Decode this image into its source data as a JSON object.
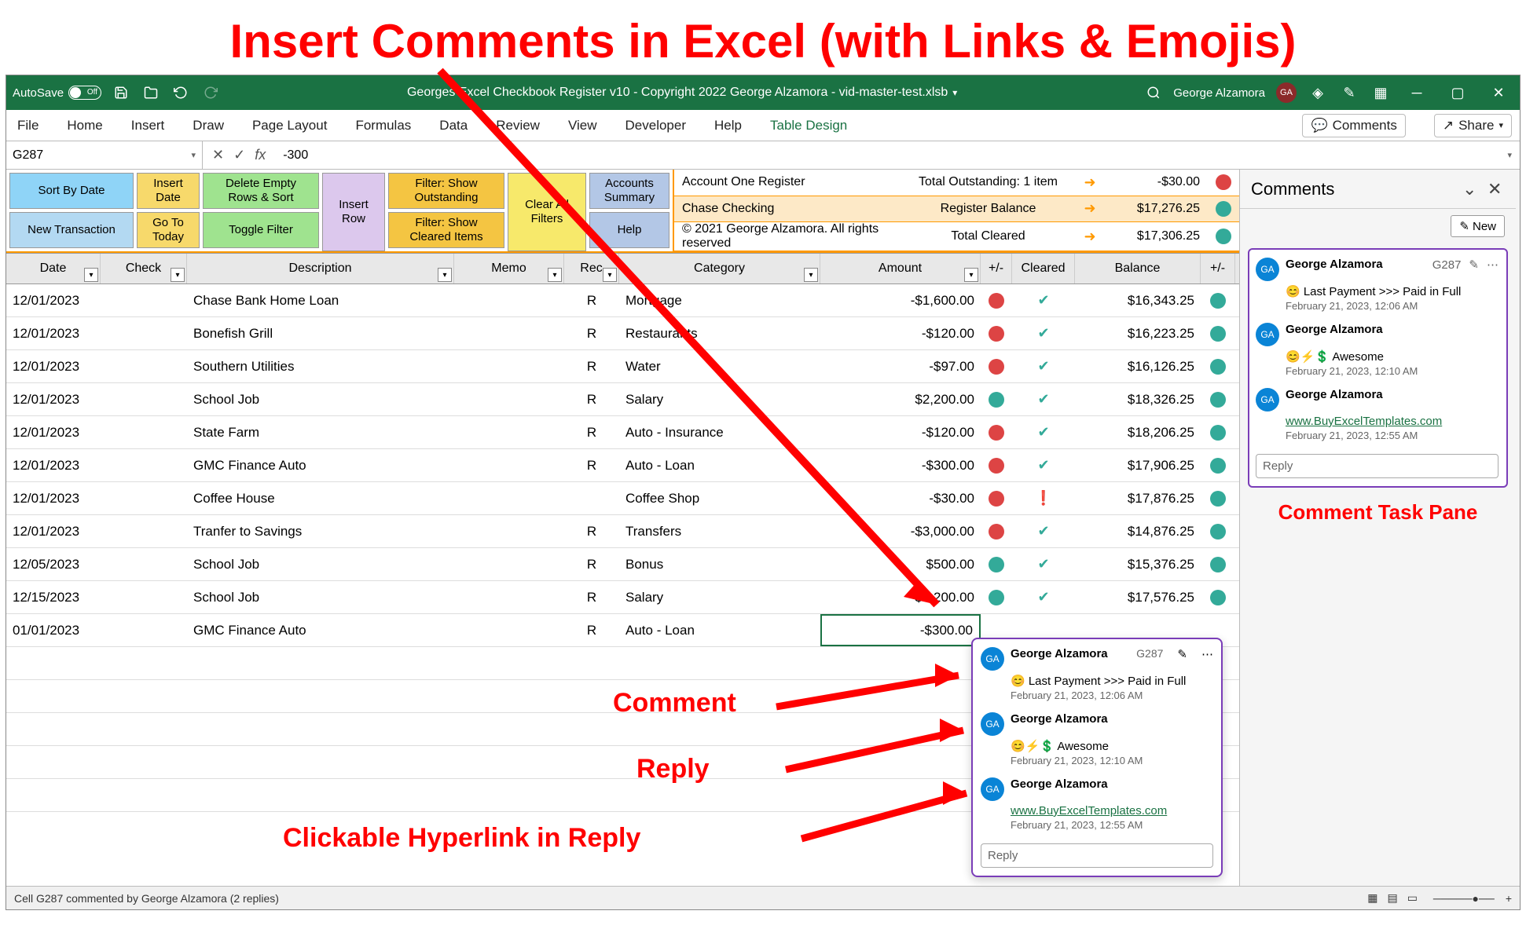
{
  "page_title": "Insert Comments in Excel (with Links & Emojis)",
  "titlebar": {
    "autosave_label": "AutoSave",
    "autosave_state": "Off",
    "doc_title": "Georges Excel Checkbook Register v10 - Copyright 2022 George Alzamora - vid-master-test.xlsb",
    "user": "George Alzamora",
    "user_initials": "GA"
  },
  "ribbon": {
    "tabs": [
      "File",
      "Home",
      "Insert",
      "Draw",
      "Page Layout",
      "Formulas",
      "Data",
      "Review",
      "View",
      "Developer",
      "Help",
      "Table Design"
    ],
    "active_tab": "Table Design",
    "comments_btn": "Comments",
    "share_btn": "Share"
  },
  "formula_bar": {
    "name_box": "G287",
    "formula": "-300"
  },
  "sheet_buttons": {
    "sort_by_date": "Sort By Date",
    "new_transaction": "New Transaction",
    "insert_date": "Insert Date",
    "go_to_today": "Go To Today",
    "delete_empty": "Delete Empty Rows & Sort",
    "toggle_filter": "Toggle Filter",
    "insert_row": "Insert Row",
    "filter_outstanding": "Filter: Show Outstanding",
    "filter_cleared": "Filter: Show Cleared Items",
    "clear_filters": "Clear All Filters",
    "accounts_summary": "Accounts Summary",
    "help": "Help"
  },
  "summary": [
    {
      "label": "Account One Register",
      "metric": "Total Outstanding: 1 item",
      "value": "-$30.00",
      "dot": "red"
    },
    {
      "label": "Chase Checking",
      "metric": "Register Balance",
      "value": "$17,276.25",
      "dot": "green"
    },
    {
      "label": "© 2021 George Alzamora. All rights reserved",
      "metric": "Total Cleared",
      "value": "$17,306.25",
      "dot": "green"
    }
  ],
  "columns": [
    "Date",
    "Check",
    "Description",
    "Memo",
    "Rec",
    "Category",
    "Amount",
    "+/-",
    "Cleared",
    "Balance",
    "+/-"
  ],
  "rows": [
    {
      "date": "12/01/2023",
      "desc": "Chase Bank Home Loan",
      "rec": "R",
      "cat": "Mortgage",
      "amt": "-$1,600.00",
      "d1": "red",
      "clr": "check",
      "bal": "$16,343.25",
      "d2": "green"
    },
    {
      "date": "12/01/2023",
      "desc": "Bonefish Grill",
      "rec": "R",
      "cat": "Restaurants",
      "amt": "-$120.00",
      "d1": "red",
      "clr": "check",
      "bal": "$16,223.25",
      "d2": "green"
    },
    {
      "date": "12/01/2023",
      "desc": "Southern Utilities",
      "rec": "R",
      "cat": "Water",
      "amt": "-$97.00",
      "d1": "red",
      "clr": "check",
      "bal": "$16,126.25",
      "d2": "green"
    },
    {
      "date": "12/01/2023",
      "desc": "School Job",
      "rec": "R",
      "cat": "Salary",
      "amt": "$2,200.00",
      "d1": "green",
      "clr": "check",
      "bal": "$18,326.25",
      "d2": "green"
    },
    {
      "date": "12/01/2023",
      "desc": "State Farm",
      "rec": "R",
      "cat": "Auto - Insurance",
      "amt": "-$120.00",
      "d1": "red",
      "clr": "check",
      "bal": "$18,206.25",
      "d2": "green"
    },
    {
      "date": "12/01/2023",
      "desc": "GMC Finance Auto",
      "rec": "R",
      "cat": "Auto - Loan",
      "amt": "-$300.00",
      "d1": "red",
      "clr": "check",
      "bal": "$17,906.25",
      "d2": "green"
    },
    {
      "date": "12/01/2023",
      "desc": "Coffee House",
      "rec": "",
      "cat": "Coffee Shop",
      "amt": "-$30.00",
      "d1": "red",
      "clr": "excl",
      "bal": "$17,876.25",
      "d2": "green"
    },
    {
      "date": "12/01/2023",
      "desc": "Tranfer to Savings",
      "rec": "R",
      "cat": "Transfers",
      "amt": "-$3,000.00",
      "d1": "red",
      "clr": "check",
      "bal": "$14,876.25",
      "d2": "green"
    },
    {
      "date": "12/05/2023",
      "desc": "School Job",
      "rec": "R",
      "cat": "Bonus",
      "amt": "$500.00",
      "d1": "green",
      "clr": "check",
      "bal": "$15,376.25",
      "d2": "green"
    },
    {
      "date": "12/15/2023",
      "desc": "School Job",
      "rec": "R",
      "cat": "Salary",
      "amt": "$2,200.00",
      "d1": "green",
      "clr": "check",
      "bal": "$17,576.25",
      "d2": "green"
    },
    {
      "date": "01/01/2023",
      "desc": "GMC Finance Auto",
      "rec": "R",
      "cat": "Auto - Loan",
      "amt": "-$300.00",
      "d1": "",
      "clr": "",
      "bal": "",
      "d2": "",
      "sel": true
    }
  ],
  "comments_pane": {
    "title": "Comments",
    "new_btn": "New",
    "thread": {
      "author": "George Alzamora",
      "initials": "GA",
      "cell_ref": "G287",
      "body": "😊 Last Payment >>> Paid in Full",
      "ts": "February 21, 2023, 12:06 AM",
      "replies": [
        {
          "author": "George Alzamora",
          "initials": "GA",
          "body": "😊⚡💲 Awesome",
          "ts": "February 21, 2023, 12:10 AM"
        },
        {
          "author": "George Alzamora",
          "initials": "GA",
          "body": "www.BuyExcelTemplates.com",
          "link": true,
          "ts": "February 21, 2023, 12:55 AM"
        }
      ],
      "reply_placeholder": "Reply"
    },
    "pane_label": "Comment Task Pane"
  },
  "popup": {
    "author": "George Alzamora",
    "initials": "GA",
    "cell_ref": "G287",
    "body": "😊 Last Payment >>> Paid in Full",
    "ts": "February 21, 2023, 12:06 AM",
    "replies": [
      {
        "author": "George Alzamora",
        "initials": "GA",
        "body": "😊⚡💲 Awesome",
        "ts": "February 21, 2023, 12:10 AM"
      },
      {
        "author": "George Alzamora",
        "initials": "GA",
        "body": "www.BuyExcelTemplates.com",
        "link": true,
        "ts": "February 21, 2023, 12:55 AM"
      }
    ],
    "reply_placeholder": "Reply"
  },
  "annotations": {
    "comment": "Comment",
    "reply": "Reply",
    "hyperlink": "Clickable Hyperlink in Reply"
  },
  "status_bar": {
    "msg": "Cell G287 commented by George Alzamora (2 replies)"
  }
}
